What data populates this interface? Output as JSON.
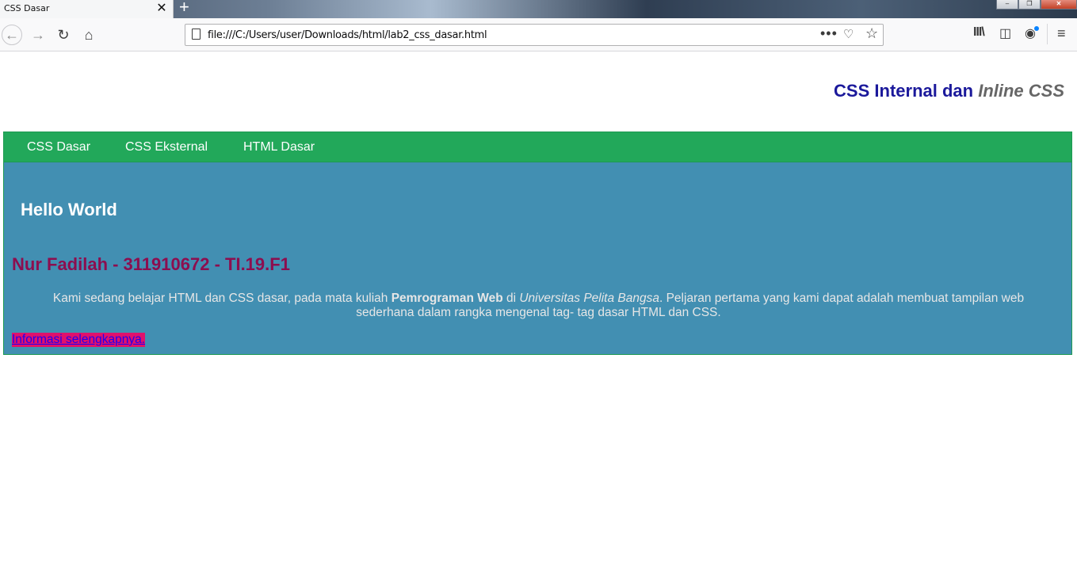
{
  "browser": {
    "tab_title": "CSS Dasar",
    "tab_close": "✕",
    "new_tab": "+",
    "url": "file:///C:/Users/user/Downloads/html/lab2_css_dasar.html",
    "icons": [
      "back-icon",
      "forward-icon",
      "reload-icon",
      "home-icon",
      "page-icon",
      "more-icon",
      "pocket-icon",
      "bookmark-star-icon",
      "library-icon",
      "sidebar-icon",
      "account-icon",
      "menu-icon"
    ]
  },
  "page": {
    "title_main": "CSS Internal dan ",
    "title_inline": "Inline CSS",
    "nav": [
      "CSS Dasar",
      "CSS Eksternal",
      "HTML Dasar"
    ],
    "hello": "Hello World",
    "name": "Nur Fadilah - 311910672 - TI.19.F1",
    "paragraph": {
      "part1": "Kami sedang belajar HTML dan CSS dasar, pada mata kuliah ",
      "bold": "Pemrograman Web",
      "part2": " di ",
      "italic": "Universitas Pelita Bangsa",
      "part3": ". Peljaran pertama yang kami dapat adalah membuat tampilan web sederhana dalam rangka mengenal tag- tag dasar HTML dan CSS."
    },
    "link": "Informasi selengkapnya."
  },
  "colors": {
    "title": "#1b199b",
    "title_inline": "#666666",
    "navbar": "#22a85a",
    "content_bg": "#428fb2",
    "name": "#8c0e4f",
    "link_bg": "#e0116c",
    "link_text": "#2200ee"
  }
}
